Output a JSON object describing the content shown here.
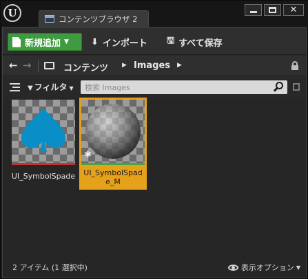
{
  "window": {
    "tab_title": "コンテンツブラウザ 2",
    "controls": [
      "minimize-icon",
      "maximize-icon",
      "close-icon"
    ]
  },
  "toolbar": {
    "add_new_label": "新規追加",
    "import_label": "インポート",
    "save_all_label": "すべて保存",
    "accent_color": "#3f9b3f"
  },
  "path": {
    "root": "コンテンツ",
    "current": "Images"
  },
  "filter": {
    "filters_label": "フィルタ",
    "search_placeholder": "検索 Images"
  },
  "assets": [
    {
      "name": "UI_SymbolSpade",
      "type": "texture",
      "selected": false,
      "underline_color": "#c83232"
    },
    {
      "name": "UI_SymbolSpade_M",
      "type": "material",
      "selected": true,
      "underline_color": "#3fa93f"
    }
  ],
  "footer": {
    "status": "2 アイテム (1 選択中)",
    "view_options_label": "表示オプション"
  },
  "colors": {
    "selection": "#e6a11b",
    "spade": "#0a8ec7"
  }
}
